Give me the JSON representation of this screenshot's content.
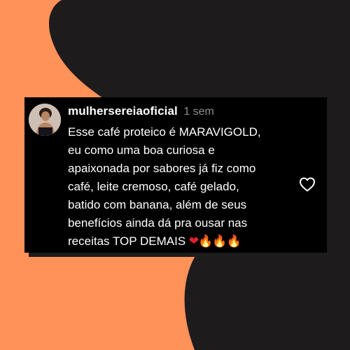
{
  "colors": {
    "background_orange": "#FF9258",
    "background_dark": "#1E1B1D",
    "card_background": "#000000",
    "username_text": "#FFFFFF",
    "time_text": "#8E8E8E",
    "heart_emoji": "#E0222B",
    "fire_emoji": "#FF8A1F"
  },
  "comment": {
    "avatar_icon": "user-avatar-photo",
    "username": "mulhersereiaoficial",
    "time": "1 sem",
    "lines": [
      "Esse café proteico é MARAVIGOLD,",
      "eu como uma boa curiosa e",
      "apaixonada por sabores já fiz como",
      "café, leite cremoso, café gelado,",
      "batido com banana, além de seus",
      "benefícios ainda dá pra ousar nas",
      "receitas TOP DEMAIS"
    ],
    "emojis": {
      "heart": "❤",
      "fire": "🔥"
    },
    "like_icon": "heart-outline-icon"
  }
}
